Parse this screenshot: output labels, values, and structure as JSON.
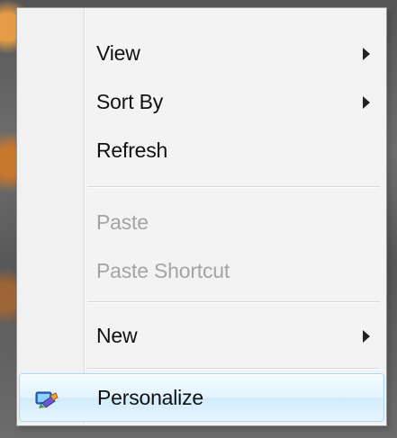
{
  "context_menu": {
    "items": [
      {
        "label": "View",
        "has_submenu": true,
        "enabled": true
      },
      {
        "label": "Sort By",
        "has_submenu": true,
        "enabled": true
      },
      {
        "label": "Refresh",
        "has_submenu": false,
        "enabled": true
      },
      {
        "label": "Paste",
        "has_submenu": false,
        "enabled": false
      },
      {
        "label": "Paste Shortcut",
        "has_submenu": false,
        "enabled": false
      },
      {
        "label": "New",
        "has_submenu": true,
        "enabled": true
      },
      {
        "label": "Personalize",
        "has_submenu": false,
        "enabled": true,
        "highlighted": true,
        "icon": "personalize-icon"
      }
    ],
    "colors": {
      "background": "#f3f3f3",
      "disabled_text": "#a4a4a4",
      "highlight_border": "#a8d8f2",
      "highlight_fill": "#e3f4ff"
    }
  }
}
